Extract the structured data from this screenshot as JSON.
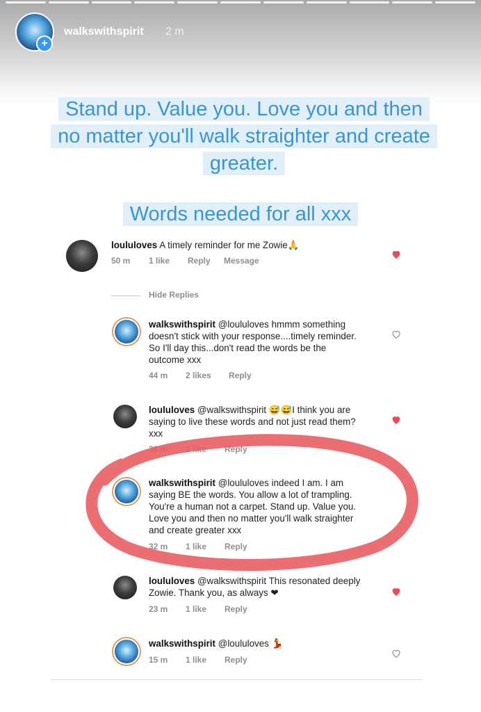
{
  "story": {
    "progress_segments": 11,
    "username": "walkswithspirit",
    "time": "2 m",
    "plus": "+",
    "quote_lines": [
      "Stand up.  Value you. Love you and then",
      "no matter you'll walk straighter and create",
      "greater."
    ],
    "quote2": "Words needed for all xxx"
  },
  "comments": [
    {
      "user": "loululoves",
      "text": "A timely reminder for me Zowie🙏",
      "time": "50 m",
      "likes": "1 like",
      "reply": "Reply",
      "extra": "Message",
      "liked": true
    },
    {
      "user": "walkswithspirit",
      "text_lines": [
        "@loululoves hmmm something",
        "doesn't stick with your response....timely reminder.",
        "So I'll day this...don't read the words be the",
        "outcome xxx"
      ],
      "time": "44 m",
      "likes": "2 likes",
      "reply": "Reply",
      "liked": false
    },
    {
      "user": "loululoves",
      "text_lines": [
        "@walkswithspirit 😅😅I think you are",
        "saying to live these words and not just read them?",
        "xxx"
      ],
      "time": "38 m",
      "likes": "1 like",
      "reply": "Reply",
      "liked": true
    },
    {
      "user": "walkswithspirit",
      "text_lines": [
        "@loululoves indeed I am.  I am",
        "saying BE the words.  You allow a lot of trampling.",
        "You're a human not a carpet.  Stand up. Value you.",
        "Love you and then no matter you'll walk straighter",
        "and create greater xxx"
      ],
      "time": "32 m",
      "likes": "1 like",
      "reply": "Reply",
      "liked": false
    },
    {
      "user": "loululoves",
      "text_lines": [
        "@walkswithspirit This resonated deeply",
        "Zowie. Thank you, as always ❤"
      ],
      "time": "23 m",
      "likes": "1 like",
      "reply": "Reply",
      "liked": true
    },
    {
      "user": "walkswithspirit",
      "text_lines": [
        "@loululoves 💃"
      ],
      "time": "15 m",
      "likes": "1 like",
      "reply": "Reply",
      "liked": false
    }
  ],
  "hide_replies": "Hide Replies",
  "colors": {
    "liked_heart": "#ed4956",
    "annotation": "#e85a5e",
    "quote_text": "#3a94d6"
  }
}
